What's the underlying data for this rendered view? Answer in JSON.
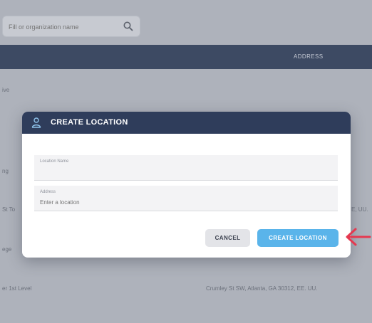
{
  "search": {
    "placeholder": "Fill or organization name"
  },
  "table": {
    "columns": {
      "address": "ADDRESS"
    },
    "rows": [
      {
        "name": "ive"
      },
      {
        "name": "ng"
      },
      {
        "name": "St To",
        "address": "E, UU."
      },
      {
        "name": "ege"
      },
      {
        "name": "er 1st Level",
        "address": "Crumley St SW, Atlanta, GA 30312, EE. UU."
      }
    ]
  },
  "modal": {
    "title": "CREATE LOCATION",
    "fields": {
      "location_name": {
        "label": "Location Name",
        "value": ""
      },
      "address": {
        "label": "Address",
        "placeholder": "Enter a location"
      }
    },
    "buttons": {
      "cancel": "CANCEL",
      "create": "CREATE LOCATION"
    }
  },
  "colors": {
    "modal_header": "#2f3d5b",
    "primary_button": "#5ab4ea",
    "annotation_arrow": "#e53950"
  }
}
